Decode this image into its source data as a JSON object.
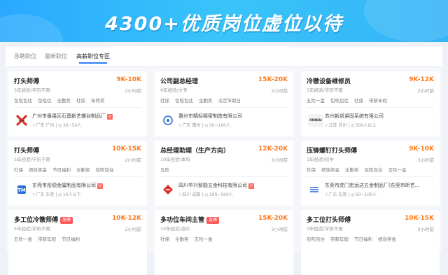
{
  "banner": {
    "title": "4300+优质岗位虚位以待"
  },
  "tabs": [
    "急聘职位",
    "最新职位",
    "高薪职位专区"
  ],
  "jobs": [
    {
      "title": "打头师傅",
      "urgent": "",
      "salary": "9K-10K",
      "req": "5年经验/学历不限",
      "time": "2小时前",
      "tags": [
        "包吃包住",
        "包吃住",
        "全勤奖",
        "社保",
        "年终奖"
      ],
      "company": "广州市番禺区石基新艺螺丝制品厂",
      "loc": "广东 广州",
      "size": "30~50人"
    },
    {
      "title": "公司副总经理",
      "urgent": "",
      "salary": "15K-20K",
      "req": "6年经验/大专",
      "time": "2小时前",
      "tags": [
        "社保",
        "包吃包住",
        "全勤奖",
        "法定节假日"
      ],
      "company": "惠州市精标精密制造有限公司",
      "loc": "广东 惠州",
      "size": "50~100人"
    },
    {
      "title": "冷镦设备维修员",
      "urgent": "",
      "salary": "9K-12K",
      "req": "5年经验/学历不限",
      "time": "2小时前",
      "tags": [
        "五险一金",
        "包吃包住",
        "社保",
        "带薪年假"
      ],
      "company": "苏州新凯紧固系统有限公司",
      "loc": "江苏 苏州",
      "size": "500人以上"
    },
    {
      "title": "打头师傅",
      "urgent": "",
      "salary": "10K-15K",
      "req": "5年经验/学历不限",
      "time": "2小时前",
      "tags": [
        "社保",
        "绩效奖金",
        "节日福利",
        "全勤奖",
        "包吃包住"
      ],
      "company": "东莞市彤德金属制品有限公司",
      "loc": "广东 东莞",
      "size": "10人以下"
    },
    {
      "title": "总经理助理（生产方向）",
      "urgent": "",
      "salary": "12K-20K",
      "req": "10年经验/本科",
      "time": "3小时前",
      "tags": [
        "五险"
      ],
      "company": "四川华兴智能五金科技有限公司",
      "loc": "四川 成都",
      "size": "100~500人"
    },
    {
      "title": "压铆螺钉打头师傅",
      "urgent": "",
      "salary": "9K-10K",
      "req": "1年经验/初中",
      "time": "3小时前",
      "tags": [
        "社保",
        "绩效奖金",
        "全勤奖",
        "包吃包住",
        "五险一金"
      ],
      "company": "东莞市虎门宏运达五金制品厂(东莞市昕艺…",
      "loc": "广东 东莞",
      "size": "50~100人"
    },
    {
      "title": "多工位冷镦师傅",
      "urgent": "急聘",
      "salary": "10K-12K",
      "req": "5年经验/学历不限",
      "time": "2小时前",
      "tags": [
        "五险一金",
        "带薪年假",
        "节日福利"
      ],
      "company": "",
      "loc": "",
      "size": ""
    },
    {
      "title": "多功位车间主管",
      "urgent": "急聘",
      "salary": "15K-20K",
      "req": "10年经验/高中",
      "time": "3小时前",
      "tags": [
        "社保",
        "全勤奖",
        "五险一金"
      ],
      "company": "",
      "loc": "",
      "size": ""
    },
    {
      "title": "多工位打头师傅",
      "urgent": "",
      "salary": "10K-15K",
      "req": "3年经验/学历不限",
      "time": "3小时前",
      "tags": [
        "包吃包住",
        "带薪年假",
        "节日福利",
        "绩效奖金"
      ],
      "company": "",
      "loc": "",
      "size": ""
    }
  ],
  "logos": [
    "red-x-logo",
    "blue-gear-logo",
    "xinkai-logo",
    "blue-tm-logo",
    "red-diamond-logo",
    "blue-lines-logo"
  ],
  "logo_texts": [
    "",
    "",
    "XINKAI",
    "",
    "",
    ""
  ],
  "colors": {
    "banner": "#38c4f9",
    "accent": "#2d7ff9",
    "salary": "#ff7a1a",
    "urgent": "#ff5a5a"
  }
}
